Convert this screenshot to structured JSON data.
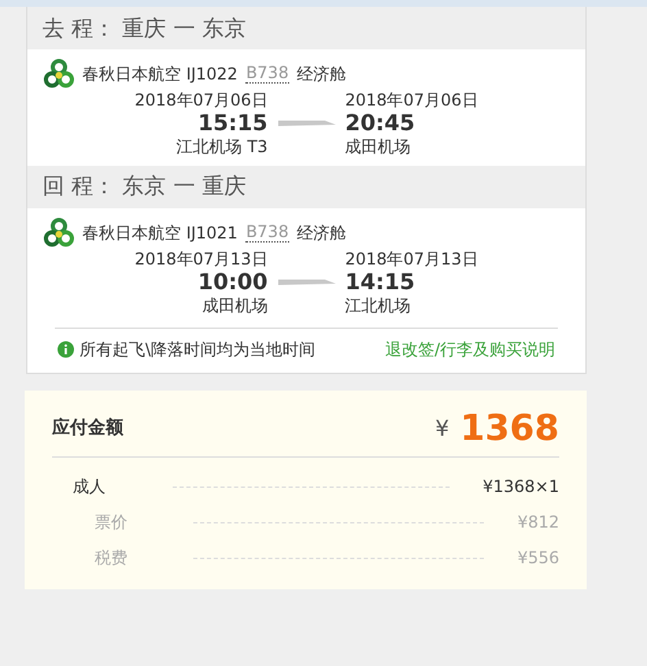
{
  "trips": [
    {
      "title": "去 程： 重庆 一 东京",
      "airline": "春秋日本航空 IJ1022",
      "aircraft": "B738",
      "cabin": "经济舱",
      "departure": {
        "date": "2018年07月06日",
        "time": "15:15",
        "airport": "江北机场 T3"
      },
      "arrival": {
        "date": "2018年07月06日",
        "time": "20:45",
        "airport": "成田机场"
      }
    },
    {
      "title": "回 程： 东京 一 重庆",
      "airline": "春秋日本航空 IJ1021",
      "aircraft": "B738",
      "cabin": "经济舱",
      "departure": {
        "date": "2018年07月13日",
        "time": "10:00",
        "airport": "成田机场"
      },
      "arrival": {
        "date": "2018年07月13日",
        "time": "14:15",
        "airport": "江北机场"
      }
    }
  ],
  "note": "所有起飞\\降落时间均为当地时间",
  "policy_link": "退改签/行李及购买说明",
  "payment": {
    "label": "应付金额",
    "currency": "¥",
    "total": "1368",
    "rows": [
      {
        "kind": "main",
        "label": "成人",
        "value": "¥1368×1"
      },
      {
        "kind": "sub",
        "label": "票价",
        "value": "¥812"
      },
      {
        "kind": "sub",
        "label": "税费",
        "value": "¥556"
      }
    ]
  }
}
